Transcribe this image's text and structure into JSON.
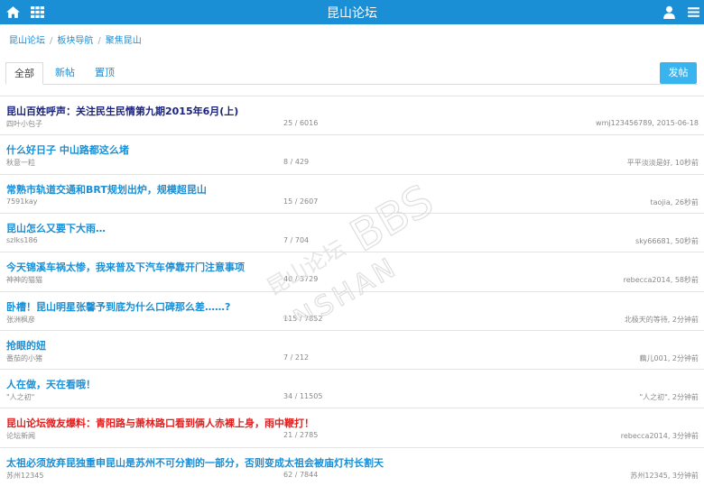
{
  "header": {
    "title": "昆山论坛",
    "icons": [
      "home-icon",
      "grid-icon",
      "user-icon",
      "menu-icon"
    ]
  },
  "breadcrumb": {
    "items": [
      "昆山论坛",
      "板块导航",
      "聚焦昆山"
    ]
  },
  "tabs": [
    {
      "label": "全部",
      "active": true
    },
    {
      "label": "新帖",
      "active": false
    },
    {
      "label": "置顶",
      "active": false
    }
  ],
  "post_button": "发帖",
  "watermark": {
    "line1": "昆山论坛",
    "line2": "BBS",
    "line3": "KUNSHAN"
  },
  "colors": {
    "header": "#1a8fd6",
    "link": "#1a8fd6",
    "navy": "#1a237e",
    "red": "#e02020",
    "button": "#3ab4ee"
  },
  "threads": [
    {
      "title": "昆山百姓呼声：关注民生民情第九期2015年6月(上)",
      "color": "#1a237e",
      "author": "四叶小包子",
      "counts": "25 / 6016",
      "last": "wmj123456789, 2015-06-18"
    },
    {
      "title": "什么好日子 中山路都这么堵",
      "color": "#1a8fd6",
      "author": "秋意一粒",
      "counts": "8 / 429",
      "last": "平平淡淡是好, 10秒前"
    },
    {
      "title": "常熟市轨道交通和BRT规划出炉，规模超昆山",
      "color": "#1a8fd6",
      "author": "7591kay",
      "counts": "15 / 2607",
      "last": "taojia, 26秒前"
    },
    {
      "title": "昆山怎么又要下大雨…",
      "color": "#1a8fd6",
      "author": "szlks186",
      "counts": "7 / 704",
      "last": "sky66681, 50秒前"
    },
    {
      "title": "今天锦溪车祸太惨，我来普及下汽车停靠开门注意事项",
      "color": "#1a8fd6",
      "author": "神神的猫猫",
      "counts": "40 / 3729",
      "last": "rebecca2014, 58秒前"
    },
    {
      "title": "卧槽！昆山明星张馨予到底为什么口碑那么差……?",
      "color": "#1a8fd6",
      "author": "张洲枫彦",
      "counts": "115 / 7852",
      "last": "北极天的等待, 2分钟前"
    },
    {
      "title": "抢眼的妞",
      "color": "#1a8fd6",
      "author": "番茄的小猪",
      "counts": "7 / 212",
      "last": "藕儿001, 2分钟前"
    },
    {
      "title": "人在做，天在看哦！",
      "color": "#1a8fd6",
      "author": "\"人之初\"",
      "counts": "34 / 11505",
      "last": "\"人之初\", 2分钟前"
    },
    {
      "title": "昆山论坛微友爆料：青阳路与萧林路口看到俩人赤裸上身，雨中鞭打！",
      "color": "#e02020",
      "author": "论坛新闻",
      "counts": "21 / 2785",
      "last": "rebecca2014, 3分钟前"
    },
    {
      "title": "太祖必须放弃昆独重申昆山是苏州不可分割的一部分，否则变成太祖会被庙灯村长割天",
      "color": "#1a8fd6",
      "author": "苏州12345",
      "counts": "62 / 7844",
      "last": "苏州12345, 3分钟前"
    }
  ]
}
